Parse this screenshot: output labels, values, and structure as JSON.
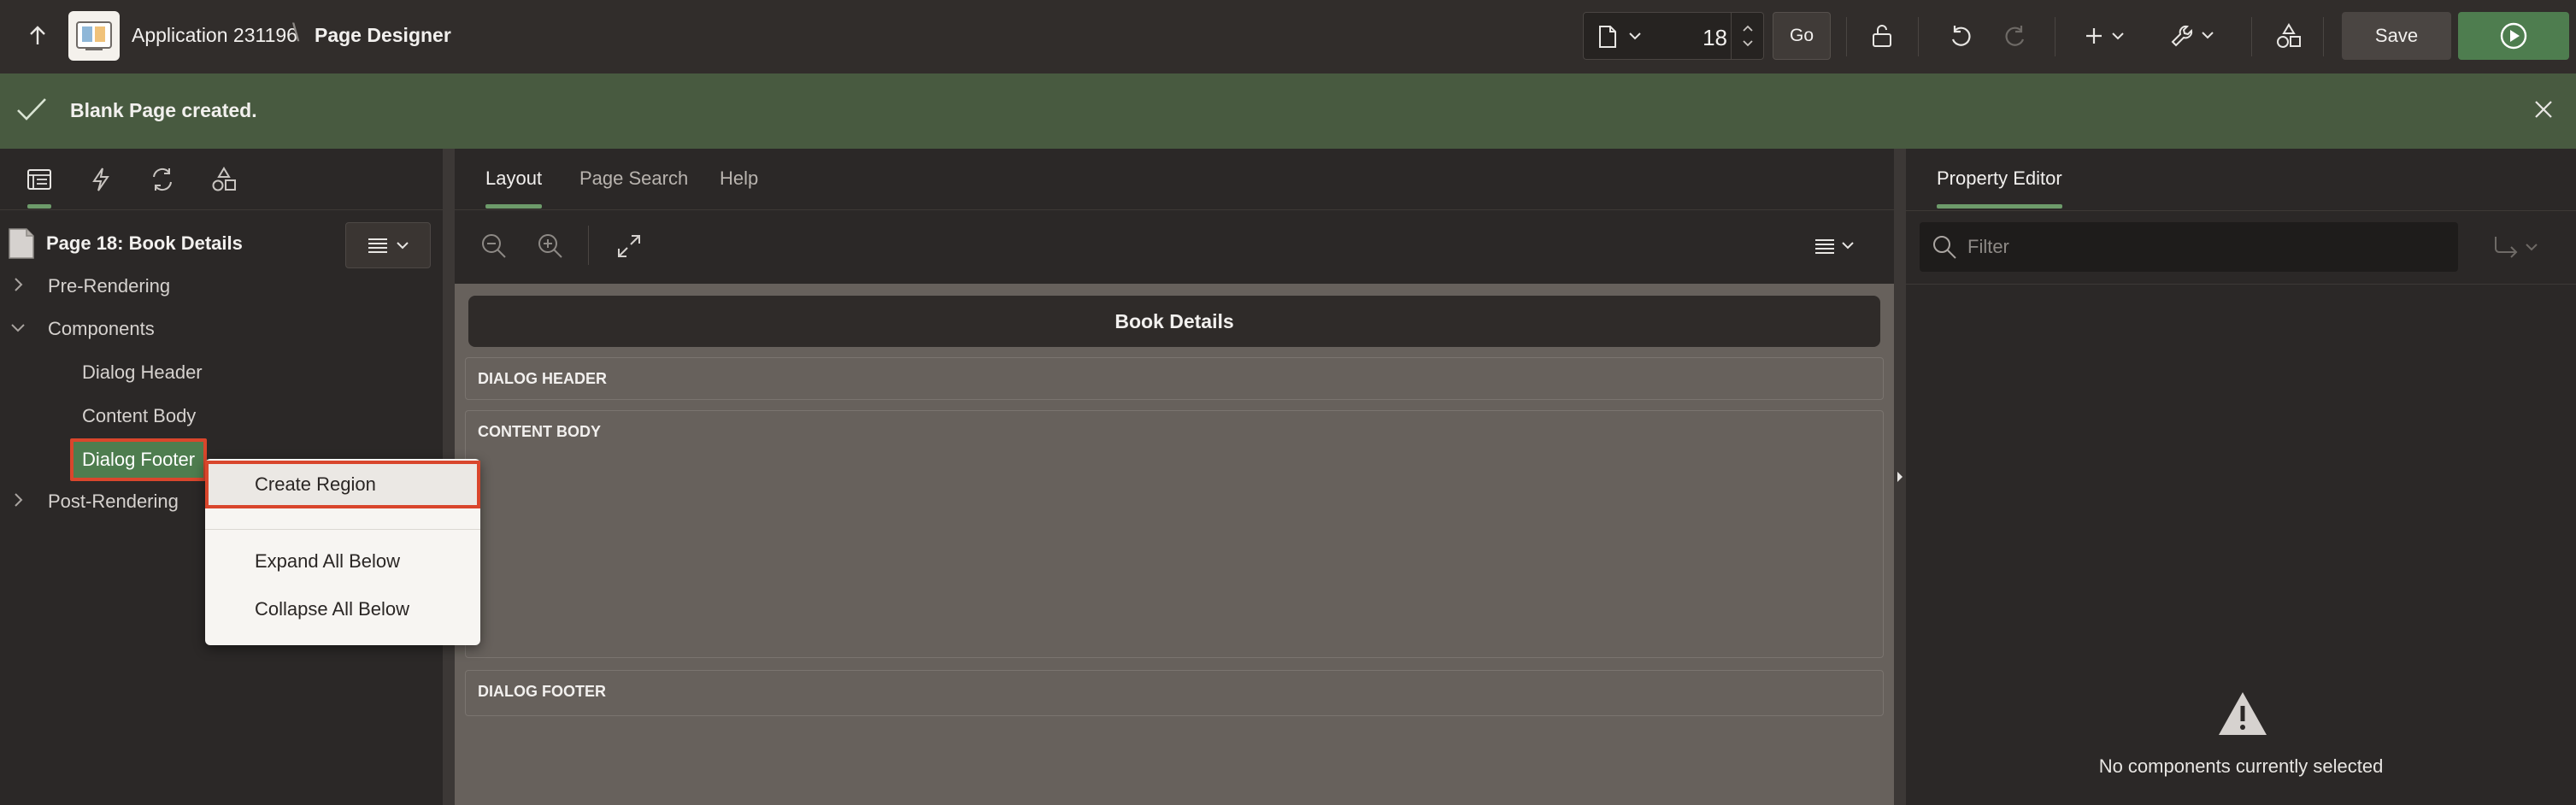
{
  "header": {
    "app_title": "Application 231196",
    "crumb_separator": "\\",
    "page_title": "Page Designer",
    "page_number": "18",
    "go_label": "Go",
    "save_label": "Save"
  },
  "notification": {
    "message": "Blank Page created."
  },
  "left_panel": {
    "tabs": [
      "rendering-icon",
      "dynamic-actions-icon",
      "processing-icon",
      "shared-components-icon"
    ],
    "tree": {
      "root_label": "Page 18: Book Details",
      "items": [
        {
          "label": "Pre-Rendering"
        },
        {
          "label": "Components"
        },
        {
          "label": "Dialog Header"
        },
        {
          "label": "Content Body"
        },
        {
          "label": "Dialog Footer"
        },
        {
          "label": "Post-Rendering"
        }
      ]
    }
  },
  "context_menu": {
    "items": [
      {
        "label": "Create Region"
      },
      {
        "label": "Expand All Below"
      },
      {
        "label": "Collapse All Below"
      }
    ]
  },
  "center": {
    "tabs": [
      {
        "label": "Layout"
      },
      {
        "label": "Page Search"
      },
      {
        "label": "Help"
      }
    ],
    "dialog_title": "Book Details",
    "regions": {
      "dialog_header": "DIALOG HEADER",
      "content_body": "CONTENT BODY",
      "dialog_footer": "DIALOG FOOTER"
    }
  },
  "right_panel": {
    "tab_label": "Property Editor",
    "filter_placeholder": "Filter",
    "empty_message": "No components currently selected"
  },
  "colors": {
    "accent_green": "#4e7d4f",
    "notice_bg": "#485a40",
    "highlight_red": "#d9462c"
  }
}
